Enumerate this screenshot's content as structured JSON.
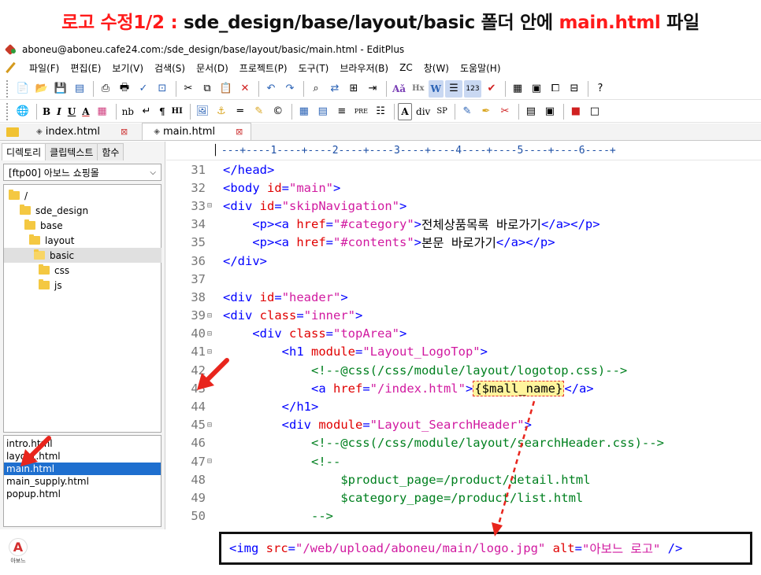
{
  "banner": {
    "part1": "로고 수정1/2 : ",
    "path": "sde_design/base/layout/basic",
    "part2": " 폴더 안에 ",
    "file": "main.html",
    "part3": " 파일"
  },
  "window": {
    "title": "aboneu@aboneu.cafe24.com:/sde_design/base/layout/basic/main.html - EditPlus"
  },
  "menu": [
    "파일(F)",
    "편집(E)",
    "보기(V)",
    "검색(S)",
    "문서(D)",
    "프로젝트(P)",
    "도구(T)",
    "브라우저(B)",
    "ZC",
    "창(W)",
    "도움말(H)"
  ],
  "toolbar2_text": {
    "bold": "B",
    "italic": "I",
    "underline": "U",
    "font": "A",
    "nb": "nb",
    "para": "¶",
    "hi": "HI",
    "div": "div",
    "sp": "SP"
  },
  "tabs": {
    "tab1": "index.html",
    "tab2": "main.html"
  },
  "sidebar": {
    "tabs": [
      "디렉토리",
      "클립텍스트",
      "함수"
    ],
    "dropdown": "[ftp00] 아보느 쇼핑몰",
    "tree": [
      {
        "label": "/",
        "depth": 0
      },
      {
        "label": "sde_design",
        "depth": 1
      },
      {
        "label": "base",
        "depth": 2
      },
      {
        "label": "layout",
        "depth": 3
      },
      {
        "label": "basic",
        "depth": 4
      },
      {
        "label": "css",
        "depth": 5
      },
      {
        "label": "js",
        "depth": 5
      }
    ],
    "files": [
      "intro.html",
      "layout.html",
      "main.html",
      "main_supply.html",
      "popup.html"
    ]
  },
  "editor": {
    "ruler": "---+----1----+----2----+----3----+----4----+----5----+----6----+",
    "lines": [
      {
        "n": "31",
        "fold": "",
        "ind": "",
        "html": [
          [
            "tag",
            "</head>"
          ]
        ]
      },
      {
        "n": "32",
        "fold": "",
        "ind": "",
        "html": [
          [
            "tag",
            "<body "
          ],
          [
            "attr",
            "id"
          ],
          [
            "tag",
            "="
          ],
          [
            "str",
            "\"main\""
          ],
          [
            "tag",
            ">"
          ]
        ]
      },
      {
        "n": "33",
        "fold": "⊟",
        "ind": "",
        "html": [
          [
            "tag",
            "<div "
          ],
          [
            "attr",
            "id"
          ],
          [
            "tag",
            "="
          ],
          [
            "str",
            "\"skipNavigation\""
          ],
          [
            "tag",
            ">"
          ]
        ]
      },
      {
        "n": "34",
        "fold": "",
        "ind": "    ",
        "html": [
          [
            "tag",
            "<p><a "
          ],
          [
            "attr",
            "href"
          ],
          [
            "tag",
            "="
          ],
          [
            "str",
            "\"#category\""
          ],
          [
            "tag",
            ">"
          ],
          [
            "txt",
            "전체상품목록 바로가기"
          ],
          [
            "tag",
            "</a></p>"
          ]
        ]
      },
      {
        "n": "35",
        "fold": "",
        "ind": "    ",
        "html": [
          [
            "tag",
            "<p><a "
          ],
          [
            "attr",
            "href"
          ],
          [
            "tag",
            "="
          ],
          [
            "str",
            "\"#contents\""
          ],
          [
            "tag",
            ">"
          ],
          [
            "txt",
            "본문 바로가기"
          ],
          [
            "tag",
            "</a></p>"
          ]
        ]
      },
      {
        "n": "36",
        "fold": "",
        "ind": "",
        "html": [
          [
            "tag",
            "</div>"
          ]
        ]
      },
      {
        "n": "37",
        "fold": "",
        "ind": "",
        "html": []
      },
      {
        "n": "38",
        "fold": "",
        "ind": "",
        "html": [
          [
            "tag",
            "<div "
          ],
          [
            "attr",
            "id"
          ],
          [
            "tag",
            "="
          ],
          [
            "str",
            "\"header\""
          ],
          [
            "tag",
            ">"
          ]
        ]
      },
      {
        "n": "39",
        "fold": "⊟",
        "ind": "",
        "html": [
          [
            "tag",
            "<div "
          ],
          [
            "attr",
            "class"
          ],
          [
            "tag",
            "="
          ],
          [
            "str",
            "\"inner\""
          ],
          [
            "tag",
            ">"
          ]
        ]
      },
      {
        "n": "40",
        "fold": "⊟",
        "ind": "    ",
        "html": [
          [
            "tag",
            "<div "
          ],
          [
            "attr",
            "class"
          ],
          [
            "tag",
            "="
          ],
          [
            "str",
            "\"topArea\""
          ],
          [
            "tag",
            ">"
          ]
        ]
      },
      {
        "n": "41",
        "fold": "⊟",
        "ind": "        ",
        "html": [
          [
            "tag",
            "<h1 "
          ],
          [
            "attr",
            "module"
          ],
          [
            "tag",
            "="
          ],
          [
            "str",
            "\"Layout_LogoTop\""
          ],
          [
            "tag",
            ">"
          ]
        ]
      },
      {
        "n": "42",
        "fold": "",
        "ind": "            ",
        "html": [
          [
            "comment",
            "<!--@css(/css/module/layout/logotop.css)-->"
          ]
        ]
      },
      {
        "n": "43",
        "fold": "",
        "ind": "            ",
        "html": [
          [
            "tag",
            "<a "
          ],
          [
            "attr",
            "href"
          ],
          [
            "tag",
            "="
          ],
          [
            "str",
            "\"/index.html\""
          ],
          [
            "tag",
            ">"
          ],
          [
            "hl",
            "{$mall_name}"
          ],
          [
            "tag",
            "</a>"
          ]
        ]
      },
      {
        "n": "44",
        "fold": "",
        "ind": "        ",
        "html": [
          [
            "tag",
            "</h1>"
          ]
        ]
      },
      {
        "n": "45",
        "fold": "⊟",
        "ind": "        ",
        "html": [
          [
            "tag",
            "<div "
          ],
          [
            "attr",
            "module"
          ],
          [
            "tag",
            "="
          ],
          [
            "str",
            "\"Layout_SearchHeader\""
          ],
          [
            "tag",
            ">"
          ]
        ]
      },
      {
        "n": "46",
        "fold": "",
        "ind": "            ",
        "html": [
          [
            "comment",
            "<!--@css(/css/module/layout/searchHeader.css)-->"
          ]
        ]
      },
      {
        "n": "47",
        "fold": "⊟",
        "ind": "            ",
        "html": [
          [
            "comment",
            "<!--"
          ]
        ]
      },
      {
        "n": "48",
        "fold": "",
        "ind": "                ",
        "html": [
          [
            "comment",
            "$product_page=/product/detail.html"
          ]
        ]
      },
      {
        "n": "49",
        "fold": "",
        "ind": "                ",
        "html": [
          [
            "comment",
            "$category_page=/product/list.html"
          ]
        ]
      },
      {
        "n": "50",
        "fold": "",
        "ind": "            ",
        "html": [
          [
            "comment",
            "-->"
          ]
        ]
      }
    ]
  },
  "snippet": {
    "tag_open": "<img ",
    "src_attr": "src",
    "src_val": "\"/web/upload/aboneu/main/logo.jpg\"",
    "alt_attr": "alt",
    "alt_val": "\"아보느 로고\"",
    "tag_close": " />"
  },
  "logo": {
    "text": "아보느",
    "mark": "A"
  },
  "colors": {
    "accent_red": "#ff1a1a",
    "tag": "#0000ff",
    "attr": "#e00000",
    "string": "#d11aa0",
    "comment": "#00801f",
    "selection": "#1e6fcf"
  }
}
